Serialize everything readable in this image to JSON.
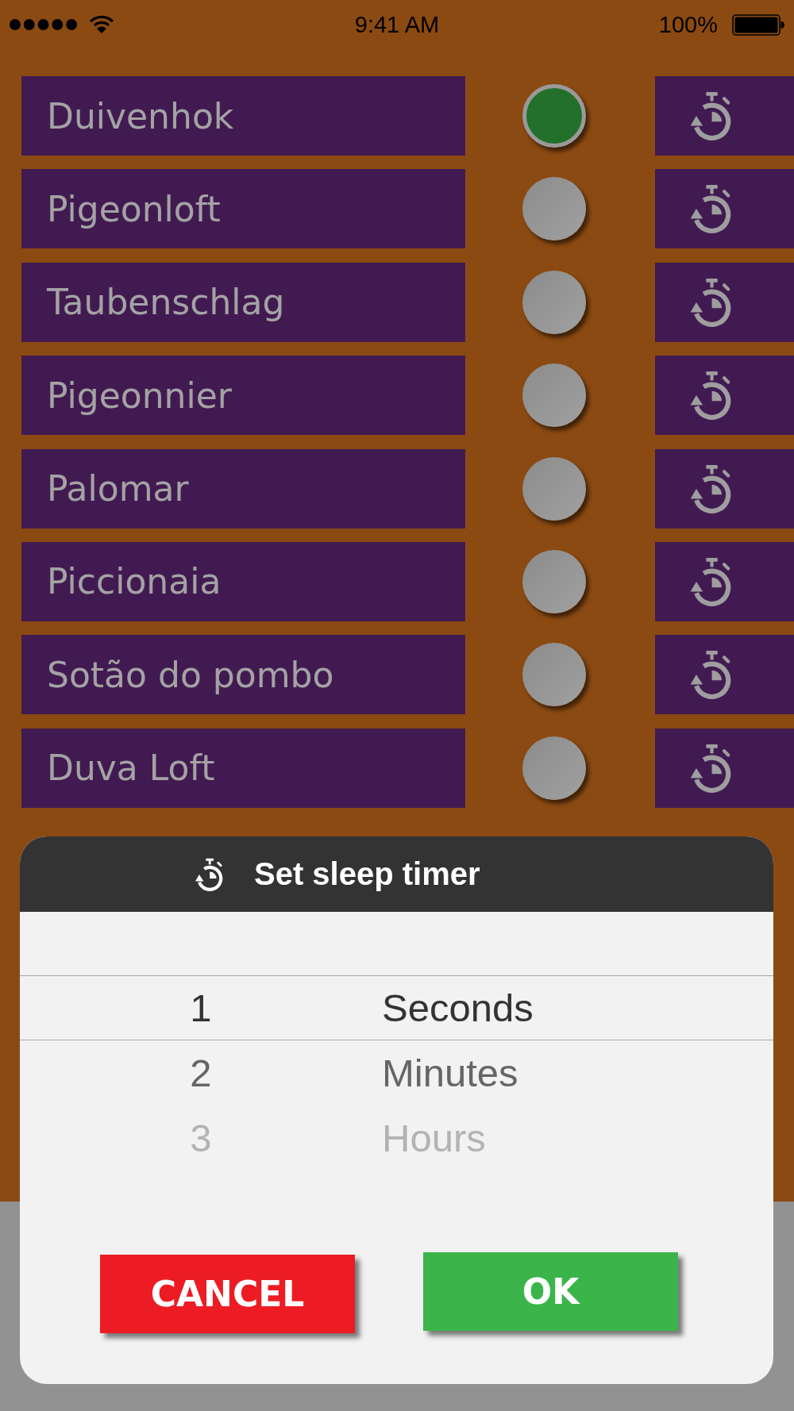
{
  "status_bar": {
    "time": "9:41 AM",
    "battery": "100%"
  },
  "rows": [
    {
      "name": "Duivenhok",
      "on": true
    },
    {
      "name": "Pigeonloft",
      "on": false
    },
    {
      "name": "Taubenschlag",
      "on": false
    },
    {
      "name": "Pigeonnier",
      "on": false
    },
    {
      "name": "Palomar",
      "on": false
    },
    {
      "name": "Piccionaia",
      "on": false
    },
    {
      "name": "Sotão do pombo",
      "on": false
    },
    {
      "name": "Duva Loft",
      "on": false
    }
  ],
  "dialog": {
    "title": "Set sleep timer",
    "picker": {
      "numbers": [
        {
          "label": "1",
          "selected": true
        },
        {
          "label": "2",
          "selected": false
        },
        {
          "label": "3",
          "selected": false
        }
      ],
      "units": [
        {
          "label": "Seconds",
          "selected": true
        },
        {
          "label": "Minutes",
          "selected": false
        },
        {
          "label": "Hours",
          "selected": false
        }
      ]
    },
    "buttons": [
      {
        "label": "CANCEL",
        "kind": "cancel"
      },
      {
        "label": "OK",
        "kind": "ok"
      }
    ]
  }
}
